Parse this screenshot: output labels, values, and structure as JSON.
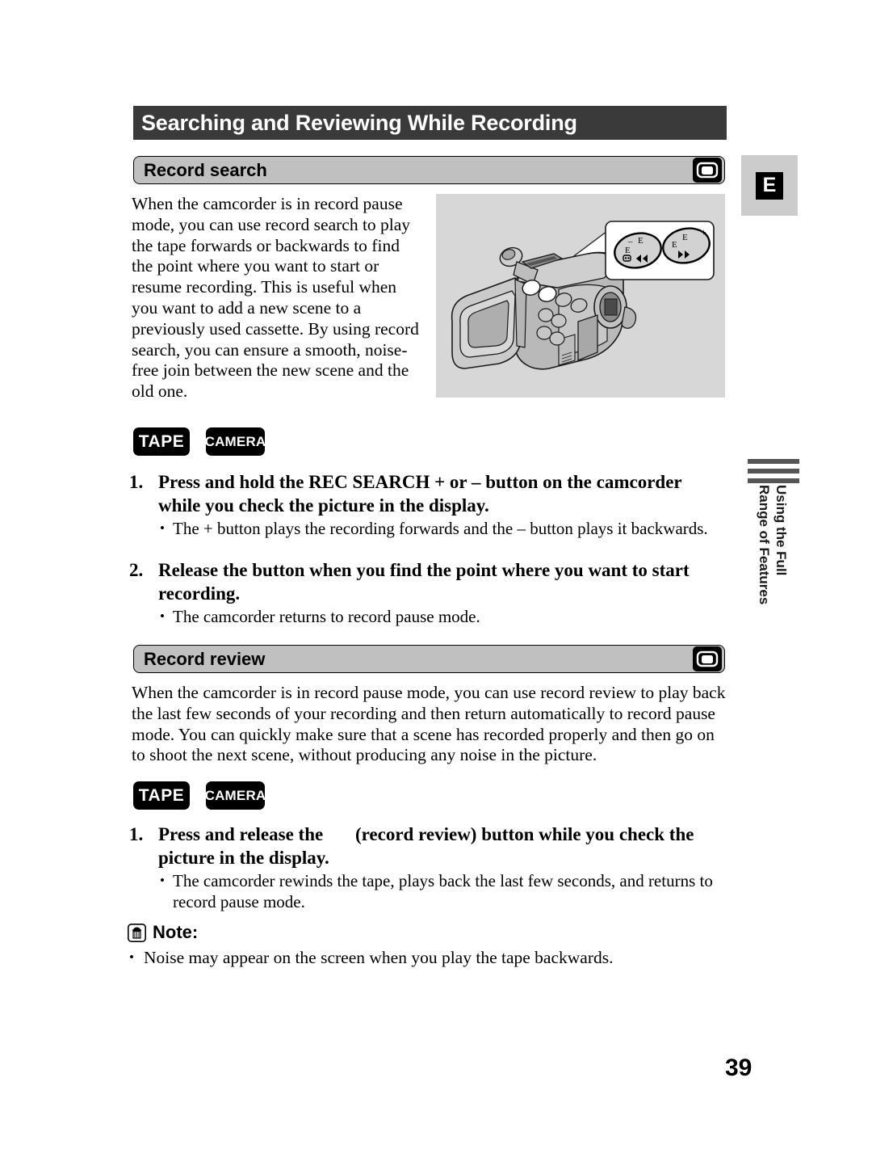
{
  "page": {
    "title": "Searching and Reviewing While Recording",
    "number": "39",
    "language_tab": "E"
  },
  "side_tab": {
    "line1": "Using the Full",
    "line2": "Range of Features"
  },
  "sections": {
    "record_search": {
      "heading": "Record search",
      "icon": "cassette-icon",
      "paragraph": "When the camcorder is in record pause mode, you can use record search to play the tape forwards or backwards to find the point where you want to start or resume recording. This is useful when you want to add a new scene to a previously used cassette. By using record search, you can ensure a smooth, noise-free join between the new scene and the old one.",
      "badges": [
        "TAPE",
        "CAMERA"
      ],
      "steps": [
        {
          "number": "1.",
          "heading_part1": "Press and hold the REC SEARCH + or – button on the camcorder while you check the picture in the display.",
          "bullets": [
            "The + button plays the recording forwards and the – button plays it backwards."
          ]
        },
        {
          "number": "2.",
          "heading_part1": "Release the button when you find the point where you want to start recording.",
          "bullets": [
            "The camcorder returns to record pause mode."
          ]
        }
      ]
    },
    "record_review": {
      "heading": "Record review",
      "icon": "cassette-icon",
      "paragraph": "When the camcorder is in record pause mode, you can use record review to play back the last few seconds of your recording and then return automatically to record pause mode. You can quickly make sure that a scene has recorded properly and then go on to shoot the next scene, without producing any noise in the picture.",
      "badges": [
        "TAPE",
        "CAMERA"
      ],
      "steps": [
        {
          "number": "1.",
          "heading_part1": "Press and release the ",
          "heading_part2": "(record review) button while you check the picture in the display.",
          "bullets": [
            "The camcorder rewinds the tape, plays back the last few seconds, and returns to record pause mode."
          ]
        }
      ]
    }
  },
  "note": {
    "heading": "Note:",
    "icon": "note-icon",
    "bullets": [
      "Noise may appear on the screen when you play the tape backwards."
    ]
  },
  "illustration": {
    "description": "camcorder-with-rec-search-buttons-callout",
    "callout": {
      "left_button": {
        "minus": "–",
        "label_top": "E",
        "label_left": "E"
      },
      "right_button": {
        "plus": "+",
        "label_top": "E",
        "label_left": "E"
      }
    }
  },
  "colors": {
    "title_bar": "#3a3a3a",
    "section_bar": "#c0c0c0",
    "illustration_bg": "#d7d7d7",
    "badge_bg": "#000000",
    "side_tab_bar": "#555555"
  }
}
